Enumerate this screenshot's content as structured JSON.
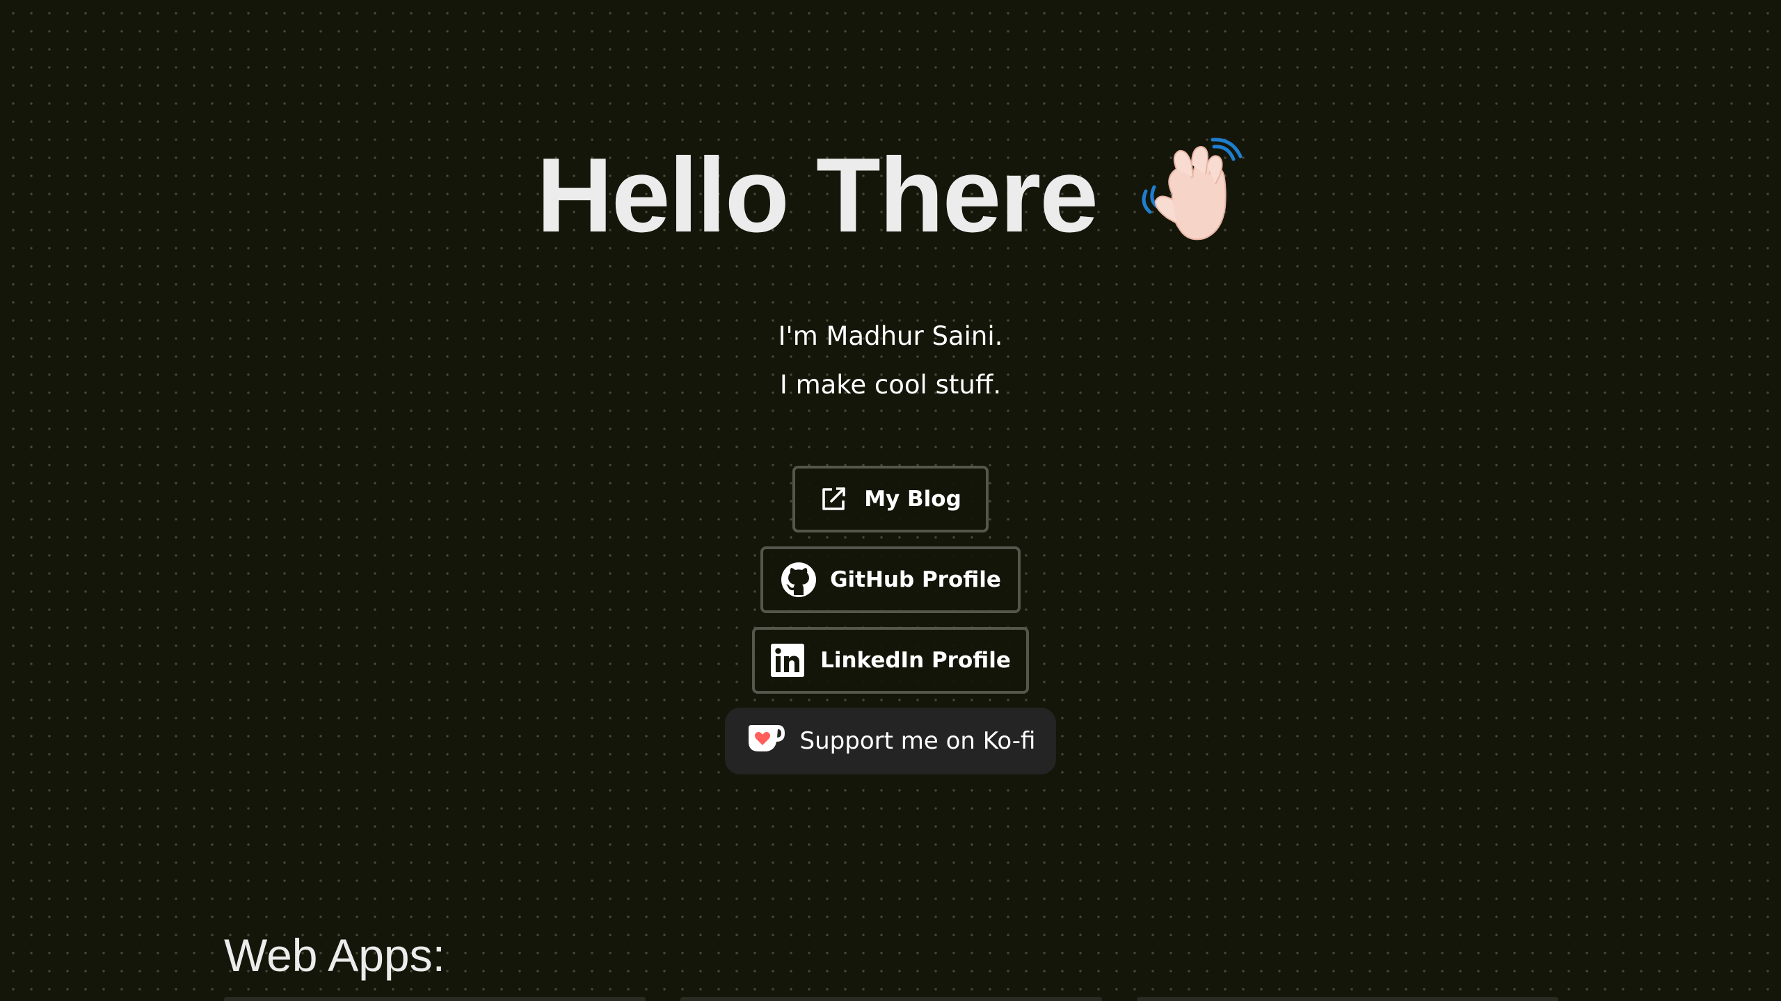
{
  "hero": {
    "title": "Hello There",
    "wave_icon": "waving-hand-icon"
  },
  "intro": {
    "line1": "I'm Madhur Saini.",
    "line2": "I make cool stuff."
  },
  "links": {
    "blog": {
      "label": "My Blog",
      "icon": "external-link-icon"
    },
    "github": {
      "label": "GitHub Profile",
      "icon": "github-icon"
    },
    "linkedin": {
      "label": "LinkedIn Profile",
      "icon": "linkedin-icon"
    },
    "kofi": {
      "label": "Support me on Ko-fi",
      "icon": "kofi-cup-icon"
    }
  },
  "sections": {
    "web_apps": "Web Apps:"
  },
  "colors": {
    "background": "#15160a",
    "dots": "#8a8d7c",
    "button_border": "#55564c",
    "kofi_bg": "#242424",
    "kofi_heart": "#ff5e5b",
    "wave_motion_lines": "#1e7fd0"
  }
}
